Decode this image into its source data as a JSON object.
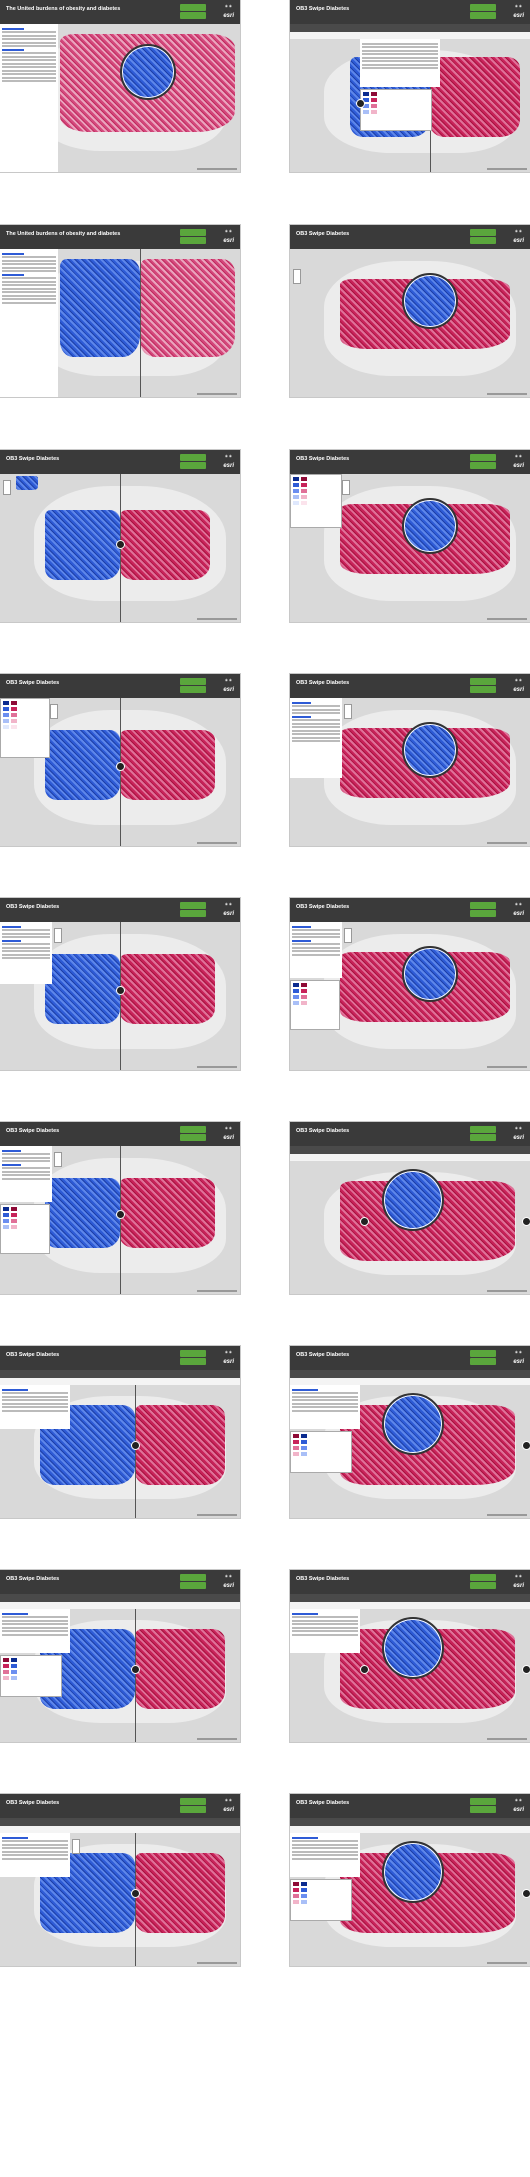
{
  "titles": {
    "a": "The United burdens of obesity and diabetes",
    "b": "OB3 Swipe Diabetes"
  },
  "legend_colors": {
    "blue": [
      "#0b2b8f",
      "#2e5bd6",
      "#6b8ef0",
      "#a9bff7",
      "#dfe8fd"
    ],
    "red": [
      "#8e0a36",
      "#c8235a",
      "#e07098",
      "#f1b4c9",
      "#fbe3ec"
    ]
  }
}
